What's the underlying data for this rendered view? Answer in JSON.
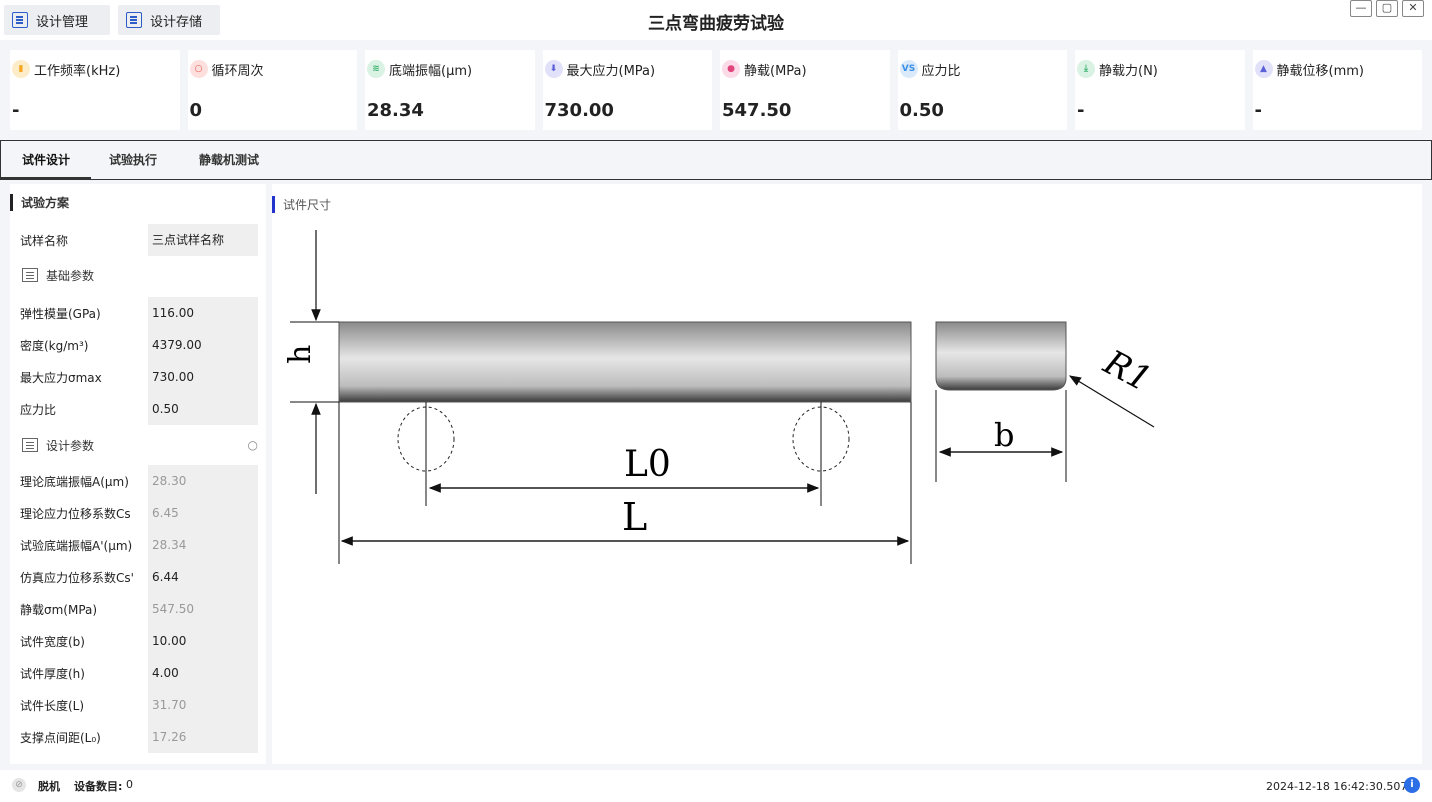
{
  "app": {
    "title": "三点弯曲疲劳试验"
  },
  "toolbar": {
    "design_manage": "设计管理",
    "design_save": "设计存储"
  },
  "window": {
    "min": "—",
    "max": "▢",
    "close": "✕"
  },
  "stats": [
    {
      "label": "工作频率(kHz)",
      "value": "-",
      "icon": "chart-icon",
      "color": "#f5a623"
    },
    {
      "label": "循环周次",
      "value": "0",
      "icon": "circle-icon",
      "color": "#e8534a"
    },
    {
      "label": "底端振幅(μm)",
      "value": "28.34",
      "icon": "wave-icon",
      "color": "#3cb371"
    },
    {
      "label": "最大应力(MPa)",
      "value": "730.00",
      "icon": "arrow-down-icon",
      "color": "#5b5fd8"
    },
    {
      "label": "静载(MPa)",
      "value": "547.50",
      "icon": "drop-icon",
      "color": "#e0457b"
    },
    {
      "label": "应力比",
      "value": "0.50",
      "icon": "vs-icon",
      "color": "#3a8ee6"
    },
    {
      "label": "静载力(N)",
      "value": "-",
      "icon": "download-icon",
      "color": "#3cb371"
    },
    {
      "label": "静载位移(mm)",
      "value": "-",
      "icon": "beaker-icon",
      "color": "#5b5fd8"
    }
  ],
  "tabs": [
    "试件设计",
    "试验执行",
    "静载机测试"
  ],
  "left": {
    "section": "试验方案",
    "sample_name_label": "试样名称",
    "sample_name_value": "三点试样名称",
    "basic_group": "基础参数",
    "basic": [
      {
        "k": "弹性模量(GPa)",
        "v": "116.00",
        "grey": false
      },
      {
        "k": "密度(kg/m³)",
        "v": "4379.00",
        "grey": false
      },
      {
        "k": "最大应力σmax",
        "v": "730.00",
        "grey": false
      },
      {
        "k": "应力比",
        "v": "0.50",
        "grey": false
      }
    ],
    "design_group": "设计参数",
    "design": [
      {
        "k": "理论底端振幅A(μm)",
        "v": "28.30",
        "grey": true
      },
      {
        "k": "理论应力位移系数Cs",
        "v": "6.45",
        "grey": true
      },
      {
        "k": "试验底端振幅A'(μm)",
        "v": "28.34",
        "grey": true
      },
      {
        "k": "仿真应力位移系数Cs'",
        "v": "6.44",
        "grey": false
      },
      {
        "k": "静载σm(MPa)",
        "v": "547.50",
        "grey": true
      },
      {
        "k": "试件宽度(b)",
        "v": "10.00",
        "grey": false
      },
      {
        "k": "试件厚度(h)",
        "v": "4.00",
        "grey": false
      },
      {
        "k": "试件长度(L)",
        "v": "31.70",
        "grey": true
      },
      {
        "k": "支撑点间距(L₀)",
        "v": "17.26",
        "grey": true
      }
    ]
  },
  "right": {
    "section": "试件尺寸",
    "dims": {
      "h": "h",
      "b": "b",
      "L0": "L0",
      "L": "L",
      "R": "R1"
    }
  },
  "status": {
    "state": "脱机",
    "device_label": "设备数目:",
    "device_count": "0",
    "time": "2024-12-18 16:42:30.507"
  }
}
